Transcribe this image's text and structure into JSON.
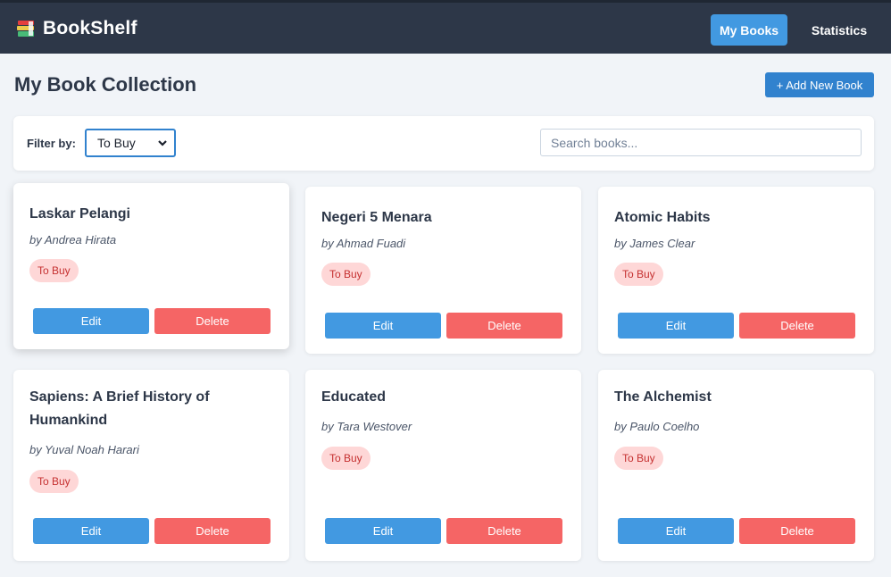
{
  "app": {
    "title": "BookShelf"
  },
  "nav": {
    "my_books": "My Books",
    "statistics": "Statistics"
  },
  "page": {
    "title": "My Book Collection",
    "add_button": "+ Add New Book"
  },
  "filter": {
    "label": "Filter by:",
    "selected": "To Buy"
  },
  "search": {
    "placeholder": "Search books..."
  },
  "colors": {
    "navbar": "#2d3748",
    "accent": "#4299e1",
    "danger": "#f56565",
    "badge_bg": "#fed7d7",
    "badge_text": "#c53030"
  },
  "books": [
    {
      "title": "Laskar Pelangi",
      "author": "by Andrea Hirata",
      "status": "To Buy",
      "edit": "Edit",
      "delete": "Delete"
    },
    {
      "title": "Negeri 5 Menara",
      "author": "by Ahmad Fuadi",
      "status": "To Buy",
      "edit": "Edit",
      "delete": "Delete"
    },
    {
      "title": "Atomic Habits",
      "author": "by James Clear",
      "status": "To Buy",
      "edit": "Edit",
      "delete": "Delete"
    },
    {
      "title": "Sapiens: A Brief History of Humankind",
      "author": "by Yuval Noah Harari",
      "status": "To Buy",
      "edit": "Edit",
      "delete": "Delete"
    },
    {
      "title": "Educated",
      "author": "by Tara Westover",
      "status": "To Buy",
      "edit": "Edit",
      "delete": "Delete"
    },
    {
      "title": "The Alchemist",
      "author": "by Paulo Coelho",
      "status": "To Buy",
      "edit": "Edit",
      "delete": "Delete"
    }
  ]
}
